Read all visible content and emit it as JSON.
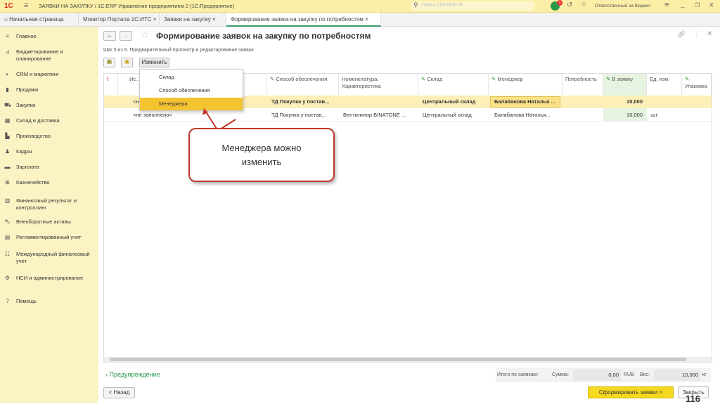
{
  "titlebar": {
    "logo": "1С",
    "title": "ЗАЯВКИ НА ЗАКУПКУ / 1С:ERP Управление предприятием 2  (1С:Предприятие)",
    "search_placeholder": "Поиск Ctrl+Shift+F",
    "user": "Ответственный за бюджет",
    "notif_count": "1"
  },
  "tabs": [
    {
      "label": "Начальная страница"
    },
    {
      "label": "Монитор Портала 1С:ИТС",
      "close": "×"
    },
    {
      "label": "Заявки на закупку",
      "close": "×"
    },
    {
      "label": "Формирование заявок на закупку по потребностям",
      "close": "×"
    }
  ],
  "sidebar": [
    {
      "label": "Главное",
      "icon": "menu"
    },
    {
      "label": "Бюджетирование и планирование",
      "icon": "chart"
    },
    {
      "label": "CRM и маркетинг",
      "icon": "crm"
    },
    {
      "label": "Продажи",
      "icon": "bag"
    },
    {
      "label": "Закупки",
      "icon": "cart"
    },
    {
      "label": "Склад и доставка",
      "icon": "warehouse"
    },
    {
      "label": "Производство",
      "icon": "factory"
    },
    {
      "label": "Кадры",
      "icon": "person"
    },
    {
      "label": "Зарплата",
      "icon": "money"
    },
    {
      "label": "Казначейство",
      "icon": "treasury"
    },
    {
      "label": "Финансовый результат и контроллинг",
      "icon": "bars"
    },
    {
      "label": "Внеоборотные активы",
      "icon": "car"
    },
    {
      "label": "Регламентированный учет",
      "icon": "doc"
    },
    {
      "label": "Международный финансовый учет",
      "icon": "intl"
    },
    {
      "label": "НСИ и администрирование",
      "icon": "gear"
    },
    {
      "label": "Помощь",
      "icon": "help"
    }
  ],
  "page": {
    "title": "Формирование заявок на закупку по потребностям",
    "step": "Шаг 5 из 6. Предварительный просмотр и редактирование заявок",
    "change_btn": "Изменить"
  },
  "dropdown": [
    "Склад",
    "Способ обеспечения",
    "Менеджера"
  ],
  "columns": [
    "!",
    "Ис... об...",
    "Способ обеспечения",
    "Номенклатура, Характеристика",
    "Склад",
    "Менеджер",
    "Потребность",
    "В заявку",
    "Ед. изм.",
    "Упаковка"
  ],
  "rows": [
    {
      "source": "<не...",
      "method": "ТД Покупка у постав...",
      "item": "",
      "warehouse": "Центральный склад",
      "manager": "Балабанова Наталья ...",
      "need": "",
      "qty": "10,000",
      "unit": ""
    },
    {
      "source": "<не заполнено>",
      "method": "ТД Покупка у постав...",
      "item": "Вентилятор BINATONE ...",
      "warehouse": "Центральный склад",
      "manager": "Балабанова Наталья...",
      "need": "",
      "qty": "10,000",
      "unit": "шт"
    }
  ],
  "callout": "Менеджера можно изменить",
  "footer": {
    "warning": "Предупреждение",
    "total_label": "Итого по заявкам:",
    "sum_label": "Сумма:",
    "sum": "0,00",
    "currency": "RUB",
    "weight_label": "Вес:",
    "weight": "10,000",
    "weight_unit": "кг",
    "back": "< Назад",
    "submit": "Сформировать заявки >",
    "close": "Закрыть"
  },
  "slide_number": "116"
}
